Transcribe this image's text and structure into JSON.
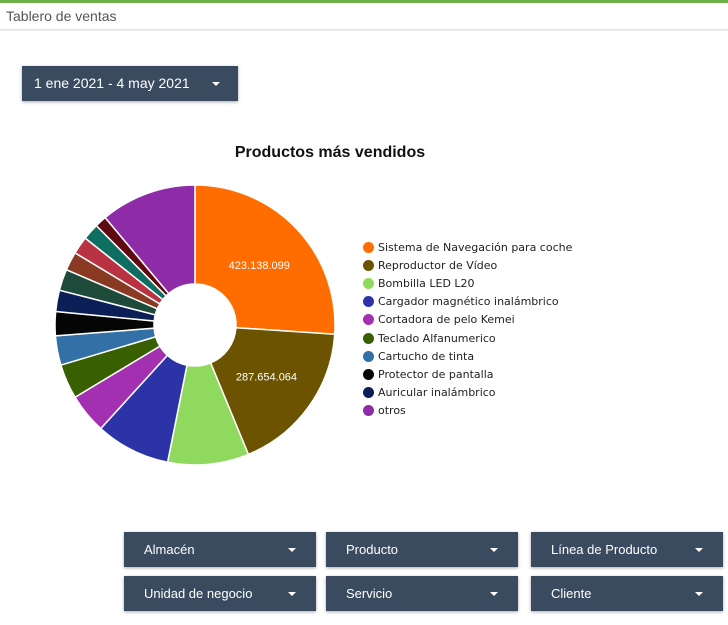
{
  "app": {
    "title": "Tablero de ventas"
  },
  "date_range": {
    "label": "1 ene 2021 - 4 may 2021"
  },
  "chart": {
    "title": "Productos más vendidos"
  },
  "chart_data": {
    "type": "pie",
    "title": "Productos más vendidos",
    "donut": true,
    "legend_position": "right",
    "slices": [
      {
        "label": "Sistema de Navegación para coche",
        "value": 423138099,
        "display": "423.138.099",
        "color": "#ff6d00"
      },
      {
        "label": "Reproductor de Vídeo",
        "value": 287654064,
        "display": "287.654.064",
        "color": "#6b5300"
      },
      {
        "label": "Bombilla LED L20",
        "value": 152000000,
        "color": "#8fd95f"
      },
      {
        "label": "Cargador magnético inalámbrico",
        "value": 140000000,
        "color": "#2b33a7"
      },
      {
        "label": "Cortadora de pelo Kemei",
        "value": 75000000,
        "color": "#a230b0"
      },
      {
        "label": "Teclado Alfanumerico",
        "value": 65000000,
        "color": "#386000"
      },
      {
        "label": "Cartucho de tinta",
        "value": 55000000,
        "color": "#3370a6"
      },
      {
        "label": "Protector de pantalla",
        "value": 45000000,
        "color": "#050505"
      },
      {
        "label": "Auricular inalámbrico",
        "value": 40000000,
        "color": "#0b1e55"
      },
      {
        "value": 40000000,
        "color": "#1e4a3a"
      },
      {
        "value": 35000000,
        "color": "#8a3a22"
      },
      {
        "value": 33000000,
        "color": "#b83242"
      },
      {
        "value": 31000000,
        "color": "#0f6e62"
      },
      {
        "value": 22000000,
        "color": "#5e0a10"
      },
      {
        "label": "otros",
        "value": 180000000,
        "color": "#8e2ba6"
      }
    ]
  },
  "legend_items": [
    {
      "label": "Sistema de Navegación para coche",
      "color": "#ff6d00"
    },
    {
      "label": "Reproductor de Vídeo",
      "color": "#6b5300"
    },
    {
      "label": "Bombilla LED L20",
      "color": "#8fd95f"
    },
    {
      "label": "Cargador magnético inalámbrico",
      "color": "#2b33a7"
    },
    {
      "label": "Cortadora de pelo Kemei",
      "color": "#a230b0"
    },
    {
      "label": "Teclado Alfanumerico",
      "color": "#386000"
    },
    {
      "label": "Cartucho de tinta",
      "color": "#3370a6"
    },
    {
      "label": "Protector de pantalla",
      "color": "#050505"
    },
    {
      "label": "Auricular inalámbrico",
      "color": "#0b1e55"
    },
    {
      "label": "otros",
      "color": "#8e2ba6"
    }
  ],
  "filters": {
    "almacen": "Almacén",
    "producto": "Producto",
    "linea_producto": "Línea de Producto",
    "unidad_negocio": "Unidad de negocio",
    "servicio": "Servicio",
    "cliente": "Cliente"
  },
  "colors": {
    "accent": "#6eb24a",
    "dropdown_bg": "#3a4a5f"
  }
}
